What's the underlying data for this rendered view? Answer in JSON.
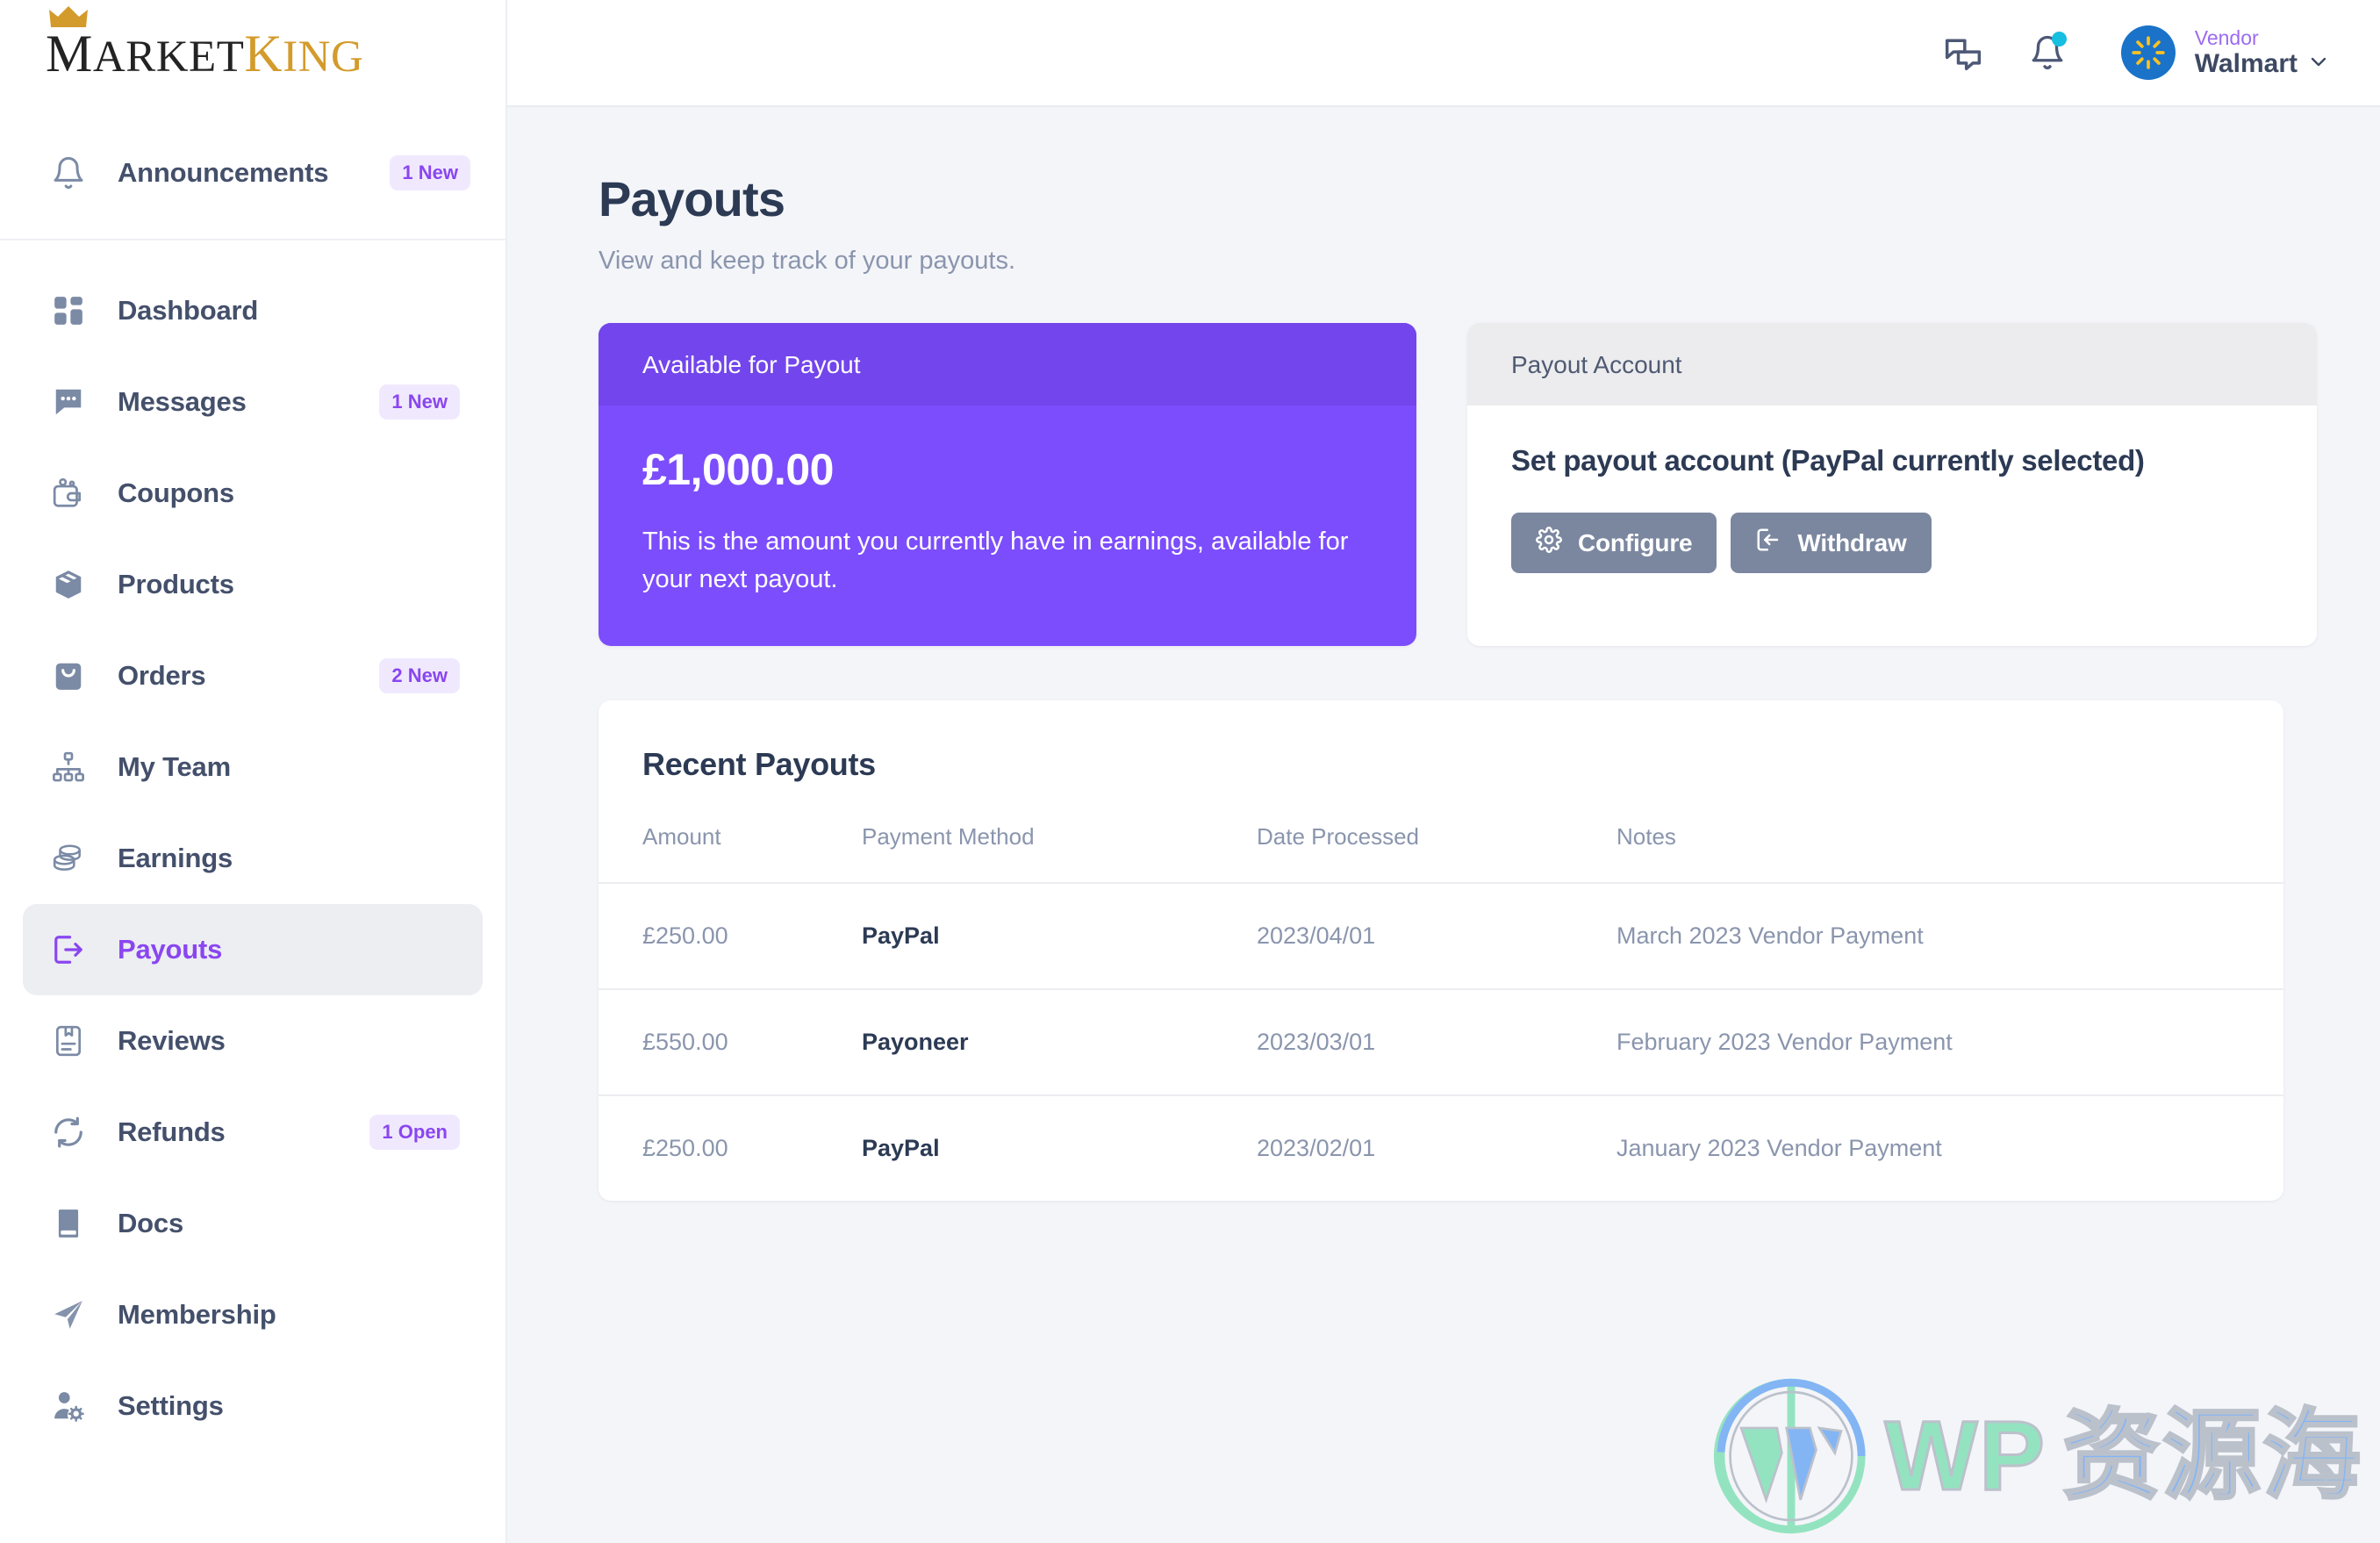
{
  "brand": {
    "name_part1": "M",
    "name_part2": "ARKET",
    "name_part3": "K",
    "name_part4": "ING",
    "crown_icon": "crown-icon"
  },
  "sidebar": {
    "announcements": {
      "label": "Announcements",
      "badge": "1 New",
      "icon": "bell-icon"
    },
    "items": [
      {
        "label": "Dashboard",
        "icon": "grid-icon",
        "badge": "",
        "active": false
      },
      {
        "label": "Messages",
        "icon": "chat-icon",
        "badge": "1 New",
        "active": false
      },
      {
        "label": "Coupons",
        "icon": "wallet-icon",
        "badge": "",
        "active": false
      },
      {
        "label": "Products",
        "icon": "box-icon",
        "badge": "",
        "active": false
      },
      {
        "label": "Orders",
        "icon": "bag-icon",
        "badge": "2 New",
        "active": false
      },
      {
        "label": "My Team",
        "icon": "org-chart-icon",
        "badge": "",
        "active": false
      },
      {
        "label": "Earnings",
        "icon": "coins-icon",
        "badge": "",
        "active": false
      },
      {
        "label": "Payouts",
        "icon": "payout-icon",
        "badge": "",
        "active": true
      },
      {
        "label": "Reviews",
        "icon": "review-icon",
        "badge": "",
        "active": false
      },
      {
        "label": "Refunds",
        "icon": "refresh-icon",
        "badge": "1 Open",
        "active": false
      },
      {
        "label": "Docs",
        "icon": "book-icon",
        "badge": "",
        "active": false
      },
      {
        "label": "Membership",
        "icon": "send-icon",
        "badge": "",
        "active": false
      },
      {
        "label": "Settings",
        "icon": "user-gear-icon",
        "badge": "",
        "active": false
      }
    ]
  },
  "topbar": {
    "messages_icon": "chat-bubbles-icon",
    "notifications_icon": "bell-icon",
    "has_notification_dot": true,
    "user_role": "Vendor",
    "user_name": "Walmart",
    "chevron_icon": "chevron-down-icon",
    "avatar_icon": "walmart-spark-icon"
  },
  "page": {
    "title": "Payouts",
    "subtitle": "View and keep track of your payouts."
  },
  "available_card": {
    "header": "Available for Payout",
    "amount": "£1,000.00",
    "description": "This is the amount you currently have in earnings, available for your next payout."
  },
  "account_card": {
    "header": "Payout Account",
    "title": "Set payout account (PayPal currently selected)",
    "configure_label": "Configure",
    "configure_icon": "gear-icon",
    "withdraw_label": "Withdraw",
    "withdraw_icon": "withdraw-icon"
  },
  "recent_payouts": {
    "title": "Recent Payouts",
    "columns": [
      "Amount",
      "Payment Method",
      "Date Processed",
      "Notes"
    ],
    "rows": [
      {
        "amount": "£250.00",
        "method": "PayPal",
        "date": "2023/04/01",
        "notes": "March 2023 Vendor Payment"
      },
      {
        "amount": "£550.00",
        "method": "Payoneer",
        "date": "2023/03/01",
        "notes": "February 2023 Vendor Payment"
      },
      {
        "amount": "£250.00",
        "method": "PayPal",
        "date": "2023/02/01",
        "notes": "January 2023 Vendor Payment"
      }
    ]
  },
  "watermark": {
    "logo_icon": "wordpress-logo-icon",
    "text_wp": "WP",
    "text_cn": "资源海"
  },
  "colors": {
    "accent_purple": "#8a46f0",
    "card_purple": "#7c4dfc",
    "card_purple_head": "#7345ec",
    "badge_bg": "#f0e9fe",
    "text_dark": "#2c3a54",
    "text_muted": "#8a95ad",
    "btn_gray": "#7b879f",
    "notification_dot": "#16bee0",
    "avatar_blue": "#1a73c8",
    "spark_yellow": "#ffc220"
  }
}
